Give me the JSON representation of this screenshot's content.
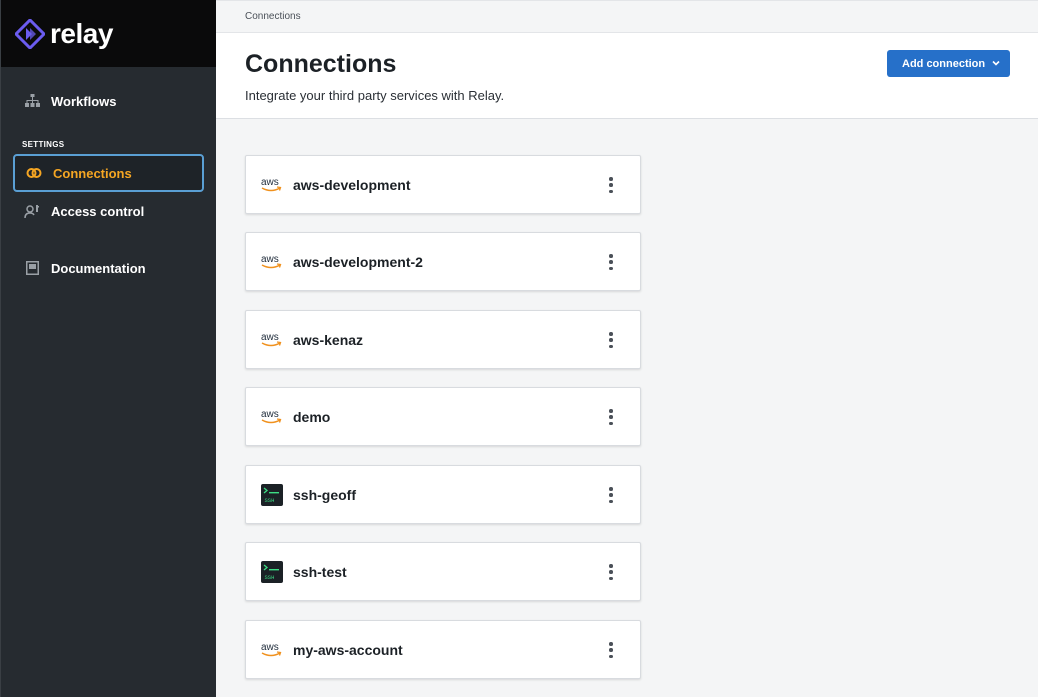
{
  "brand": {
    "name": "relay",
    "logo_icon": "relay-diamond-logo",
    "accent": "#6b5cf0"
  },
  "sidebar": {
    "items": [
      {
        "label": "Workflows",
        "icon": "workflow-tree-icon",
        "active": false
      },
      {
        "label": "Connections",
        "icon": "connections-link-icon",
        "active": true
      },
      {
        "label": "Access control",
        "icon": "user-key-icon",
        "active": false
      },
      {
        "label": "Documentation",
        "icon": "book-icon",
        "active": false
      }
    ],
    "section_label": "SETTINGS",
    "active_color": "#f5a623",
    "active_border": "#5a9fd4"
  },
  "breadcrumb": "Connections",
  "header": {
    "title": "Connections",
    "subtitle": "Integrate your third party services with Relay.",
    "add_button_label": "Add connection",
    "add_button_color": "#2670c9"
  },
  "connections": [
    {
      "name": "aws-development",
      "type": "aws",
      "icon": "aws-icon"
    },
    {
      "name": "aws-development-2",
      "type": "aws",
      "icon": "aws-icon"
    },
    {
      "name": "aws-kenaz",
      "type": "aws",
      "icon": "aws-icon"
    },
    {
      "name": "demo",
      "type": "aws",
      "icon": "aws-icon"
    },
    {
      "name": "ssh-geoff",
      "type": "ssh",
      "icon": "ssh-terminal-icon"
    },
    {
      "name": "ssh-test",
      "type": "ssh",
      "icon": "ssh-terminal-icon"
    },
    {
      "name": "my-aws-account",
      "type": "aws",
      "icon": "aws-icon"
    }
  ],
  "icon_text": {
    "aws": "aws",
    "ssh": "SSH"
  }
}
